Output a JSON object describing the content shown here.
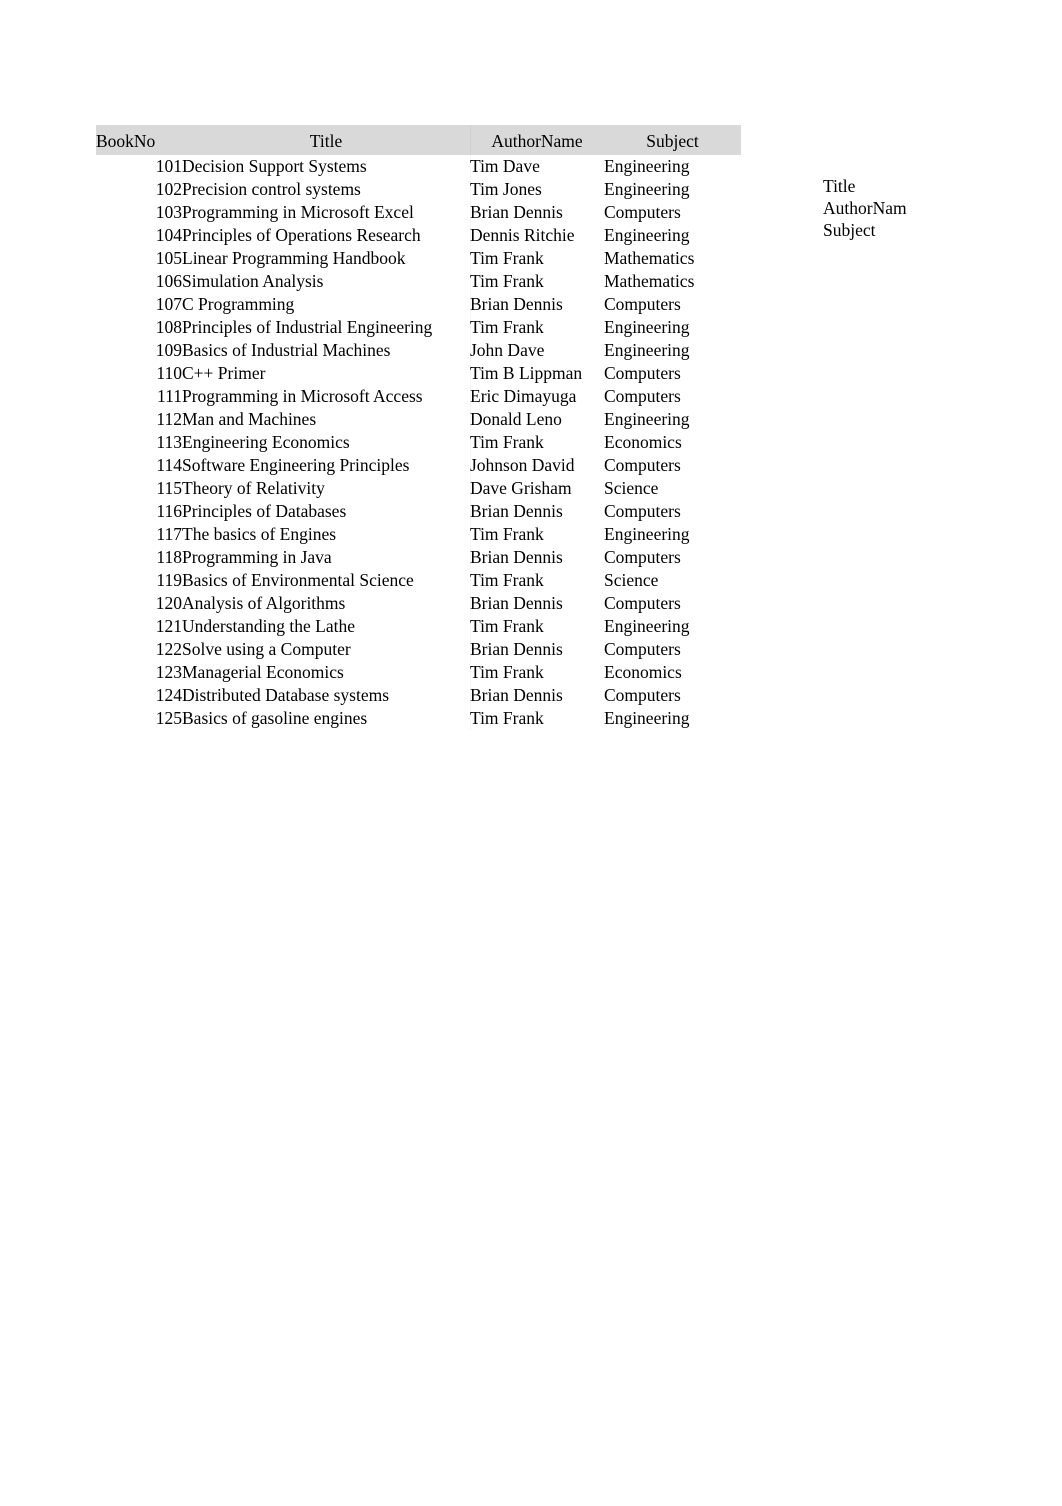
{
  "table": {
    "columns": [
      {
        "key": "bookno",
        "label": "BookNo",
        "align": "right"
      },
      {
        "key": "title",
        "label": "Title",
        "align": "left"
      },
      {
        "key": "author",
        "label": "AuthorName",
        "align": "left"
      },
      {
        "key": "subject",
        "label": "Subject",
        "align": "left"
      }
    ],
    "header_background": "#d9d9d9",
    "rows": [
      {
        "bookno": "101",
        "title": "Decision Support Systems",
        "author": "Tim Dave",
        "subject": "Engineering"
      },
      {
        "bookno": "102",
        "title": "Precision control systems",
        "author": "Tim Jones",
        "subject": "Engineering"
      },
      {
        "bookno": "103",
        "title": "Programming in Microsoft Excel",
        "author": "Brian Dennis",
        "subject": "Computers"
      },
      {
        "bookno": "104",
        "title": "Principles of Operations Research",
        "author": "Dennis Ritchie",
        "subject": "Engineering"
      },
      {
        "bookno": "105",
        "title": "Linear Programming Handbook",
        "author": "Tim Frank",
        "subject": "Mathematics"
      },
      {
        "bookno": "106",
        "title": "Simulation Analysis",
        "author": "Tim Frank",
        "subject": "Mathematics"
      },
      {
        "bookno": "107",
        "title": "C Programming",
        "author": "Brian Dennis",
        "subject": "Computers"
      },
      {
        "bookno": "108",
        "title": "Principles of Industrial Engineering",
        "author": "Tim Frank",
        "subject": "Engineering"
      },
      {
        "bookno": "109",
        "title": "Basics of Industrial Machines",
        "author": "John Dave",
        "subject": "Engineering"
      },
      {
        "bookno": "110",
        "title": "C++ Primer",
        "author": "Tim B Lippman",
        "subject": "Computers"
      },
      {
        "bookno": "111",
        "title": "Programming in Microsoft Access",
        "author": "Eric Dimayuga",
        "subject": "Computers"
      },
      {
        "bookno": "112",
        "title": "Man and Machines",
        "author": "Donald Leno",
        "subject": "Engineering"
      },
      {
        "bookno": "113",
        "title": "Engineering Economics",
        "author": "Tim Frank",
        "subject": "Economics"
      },
      {
        "bookno": "114",
        "title": "Software Engineering Principles",
        "author": "Johnson David",
        "subject": "Computers"
      },
      {
        "bookno": "115",
        "title": "Theory of Relativity",
        "author": "Dave Grisham",
        "subject": "Science"
      },
      {
        "bookno": "116",
        "title": "Principles of Databases",
        "author": "Brian Dennis",
        "subject": "Computers"
      },
      {
        "bookno": "117",
        "title": "The basics of Engines",
        "author": "Tim Frank",
        "subject": "Engineering"
      },
      {
        "bookno": "118",
        "title": "Programming in Java",
        "author": "Brian Dennis",
        "subject": "Computers"
      },
      {
        "bookno": "119",
        "title": "Basics of Environmental Science",
        "author": "Tim Frank",
        "subject": "Science"
      },
      {
        "bookno": "120",
        "title": "Analysis of Algorithms",
        "author": "Brian Dennis",
        "subject": "Computers"
      },
      {
        "bookno": "121",
        "title": "Understanding the Lathe",
        "author": "Tim Frank",
        "subject": "Engineering"
      },
      {
        "bookno": "122",
        "title": "Solve using a Computer",
        "author": "Brian Dennis",
        "subject": "Computers"
      },
      {
        "bookno": "123",
        "title": "Managerial Economics",
        "author": "Tim Frank",
        "subject": "Economics"
      },
      {
        "bookno": "124",
        "title": "Distributed Database systems",
        "author": "Brian Dennis",
        "subject": "Computers"
      },
      {
        "bookno": "125",
        "title": "Basics of gasoline engines",
        "author": "Tim Frank",
        "subject": "Engineering"
      }
    ]
  },
  "field_list": {
    "items": [
      {
        "label": "Title"
      },
      {
        "label": "AuthorNam"
      },
      {
        "label": "Subject"
      }
    ]
  }
}
